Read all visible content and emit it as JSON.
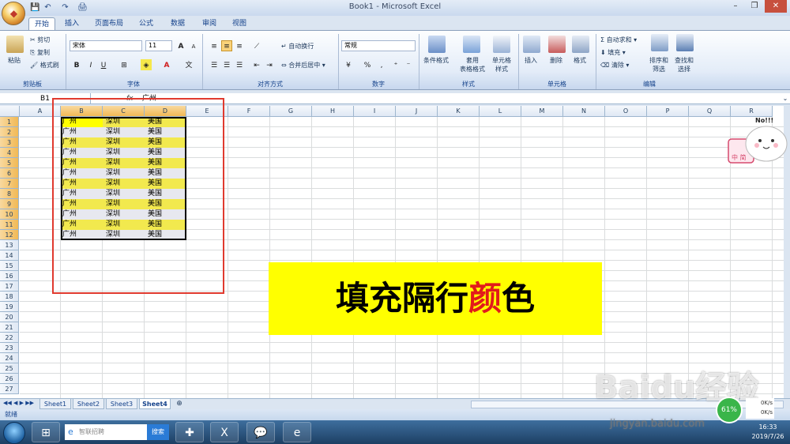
{
  "window": {
    "title": "Book1 - Microsoft Excel"
  },
  "qat": {
    "save": "💾",
    "undo": "↶",
    "redo": "↷",
    "print": "🖨"
  },
  "tabs": [
    {
      "label": "开始"
    },
    {
      "label": "插入"
    },
    {
      "label": "页面布局"
    },
    {
      "label": "公式"
    },
    {
      "label": "数据"
    },
    {
      "label": "审阅"
    },
    {
      "label": "视图"
    }
  ],
  "ribbon": {
    "clipboard": {
      "paste": "粘贴",
      "cut": "剪切",
      "copy": "复制",
      "format_painter": "格式刷",
      "label": "剪贴板"
    },
    "font": {
      "name": "宋体",
      "size": "11",
      "bold": "B",
      "italic": "I",
      "underline": "U",
      "grow": "A",
      "shrink": "A",
      "label": "字体"
    },
    "alignment": {
      "wrap": "自动换行",
      "merge": "合并后居中",
      "label": "对齐方式"
    },
    "number": {
      "format": "常规",
      "percent": "%",
      "comma": ",",
      "label": "数字"
    },
    "styles": {
      "conditional": "条件格式",
      "table": "套用\n表格格式",
      "cell_styles": "单元格\n样式",
      "label": "样式"
    },
    "cells": {
      "insert": "插入",
      "delete": "删除",
      "format": "格式",
      "label": "单元格"
    },
    "editing": {
      "autosum": "自动求和",
      "fill": "填充",
      "clear": "清除",
      "sort": "排序和\n筛选",
      "find": "查找和\n选择",
      "label": "编辑"
    }
  },
  "formula_bar": {
    "name_box": "B1",
    "fx": "fx",
    "value": "广州"
  },
  "columns": [
    "A",
    "B",
    "C",
    "D",
    "E",
    "F",
    "G",
    "H",
    "I",
    "J",
    "K",
    "L",
    "M",
    "N",
    "O",
    "P",
    "Q",
    "R"
  ],
  "rows": [
    "1",
    "2",
    "3",
    "4",
    "5",
    "6",
    "7",
    "8",
    "9",
    "10",
    "11",
    "12",
    "13",
    "14",
    "15",
    "16",
    "17",
    "18",
    "19",
    "20",
    "21",
    "22",
    "23",
    "24",
    "25",
    "26",
    "27"
  ],
  "data_rows": [
    [
      "广州",
      "深圳",
      "美国"
    ],
    [
      "广州",
      "深圳",
      "美国"
    ],
    [
      "广州",
      "深圳",
      "美国"
    ],
    [
      "广州",
      "深圳",
      "美国"
    ],
    [
      "广州",
      "深圳",
      "美国"
    ],
    [
      "广州",
      "深圳",
      "美国"
    ],
    [
      "广州",
      "深圳",
      "美国"
    ],
    [
      "广州",
      "深圳",
      "美国"
    ],
    [
      "广州",
      "深圳",
      "美国"
    ],
    [
      "广州",
      "深圳",
      "美国"
    ],
    [
      "广州",
      "深圳",
      "美国"
    ],
    [
      "广州",
      "深圳",
      "美国"
    ]
  ],
  "colors": {
    "band_yellow": "#f2e94e",
    "band_gray": "#e7e8ef",
    "banner_bg": "#ffff00",
    "accent_red": "#e21b1b"
  },
  "sheets": [
    {
      "label": "Sheet1"
    },
    {
      "label": "Sheet2"
    },
    {
      "label": "Sheet3"
    },
    {
      "label": "Sheet4"
    }
  ],
  "status": {
    "ready": "就绪"
  },
  "banner": {
    "before": "填充隔行",
    "accent": "颜",
    "after": "色"
  },
  "sticker": {
    "text": "No!!!",
    "badge": "中 简"
  },
  "watermark": {
    "brand": "Baidu经验",
    "url": "jingyan.baidu.com"
  },
  "taskbar": {
    "search_placeholder": "智联招聘",
    "search_button": "搜索",
    "time": "16:33",
    "date": "2019/7/26",
    "net_percent": "61%",
    "up_speed": "0K/s",
    "down_speed": "0K/s"
  }
}
